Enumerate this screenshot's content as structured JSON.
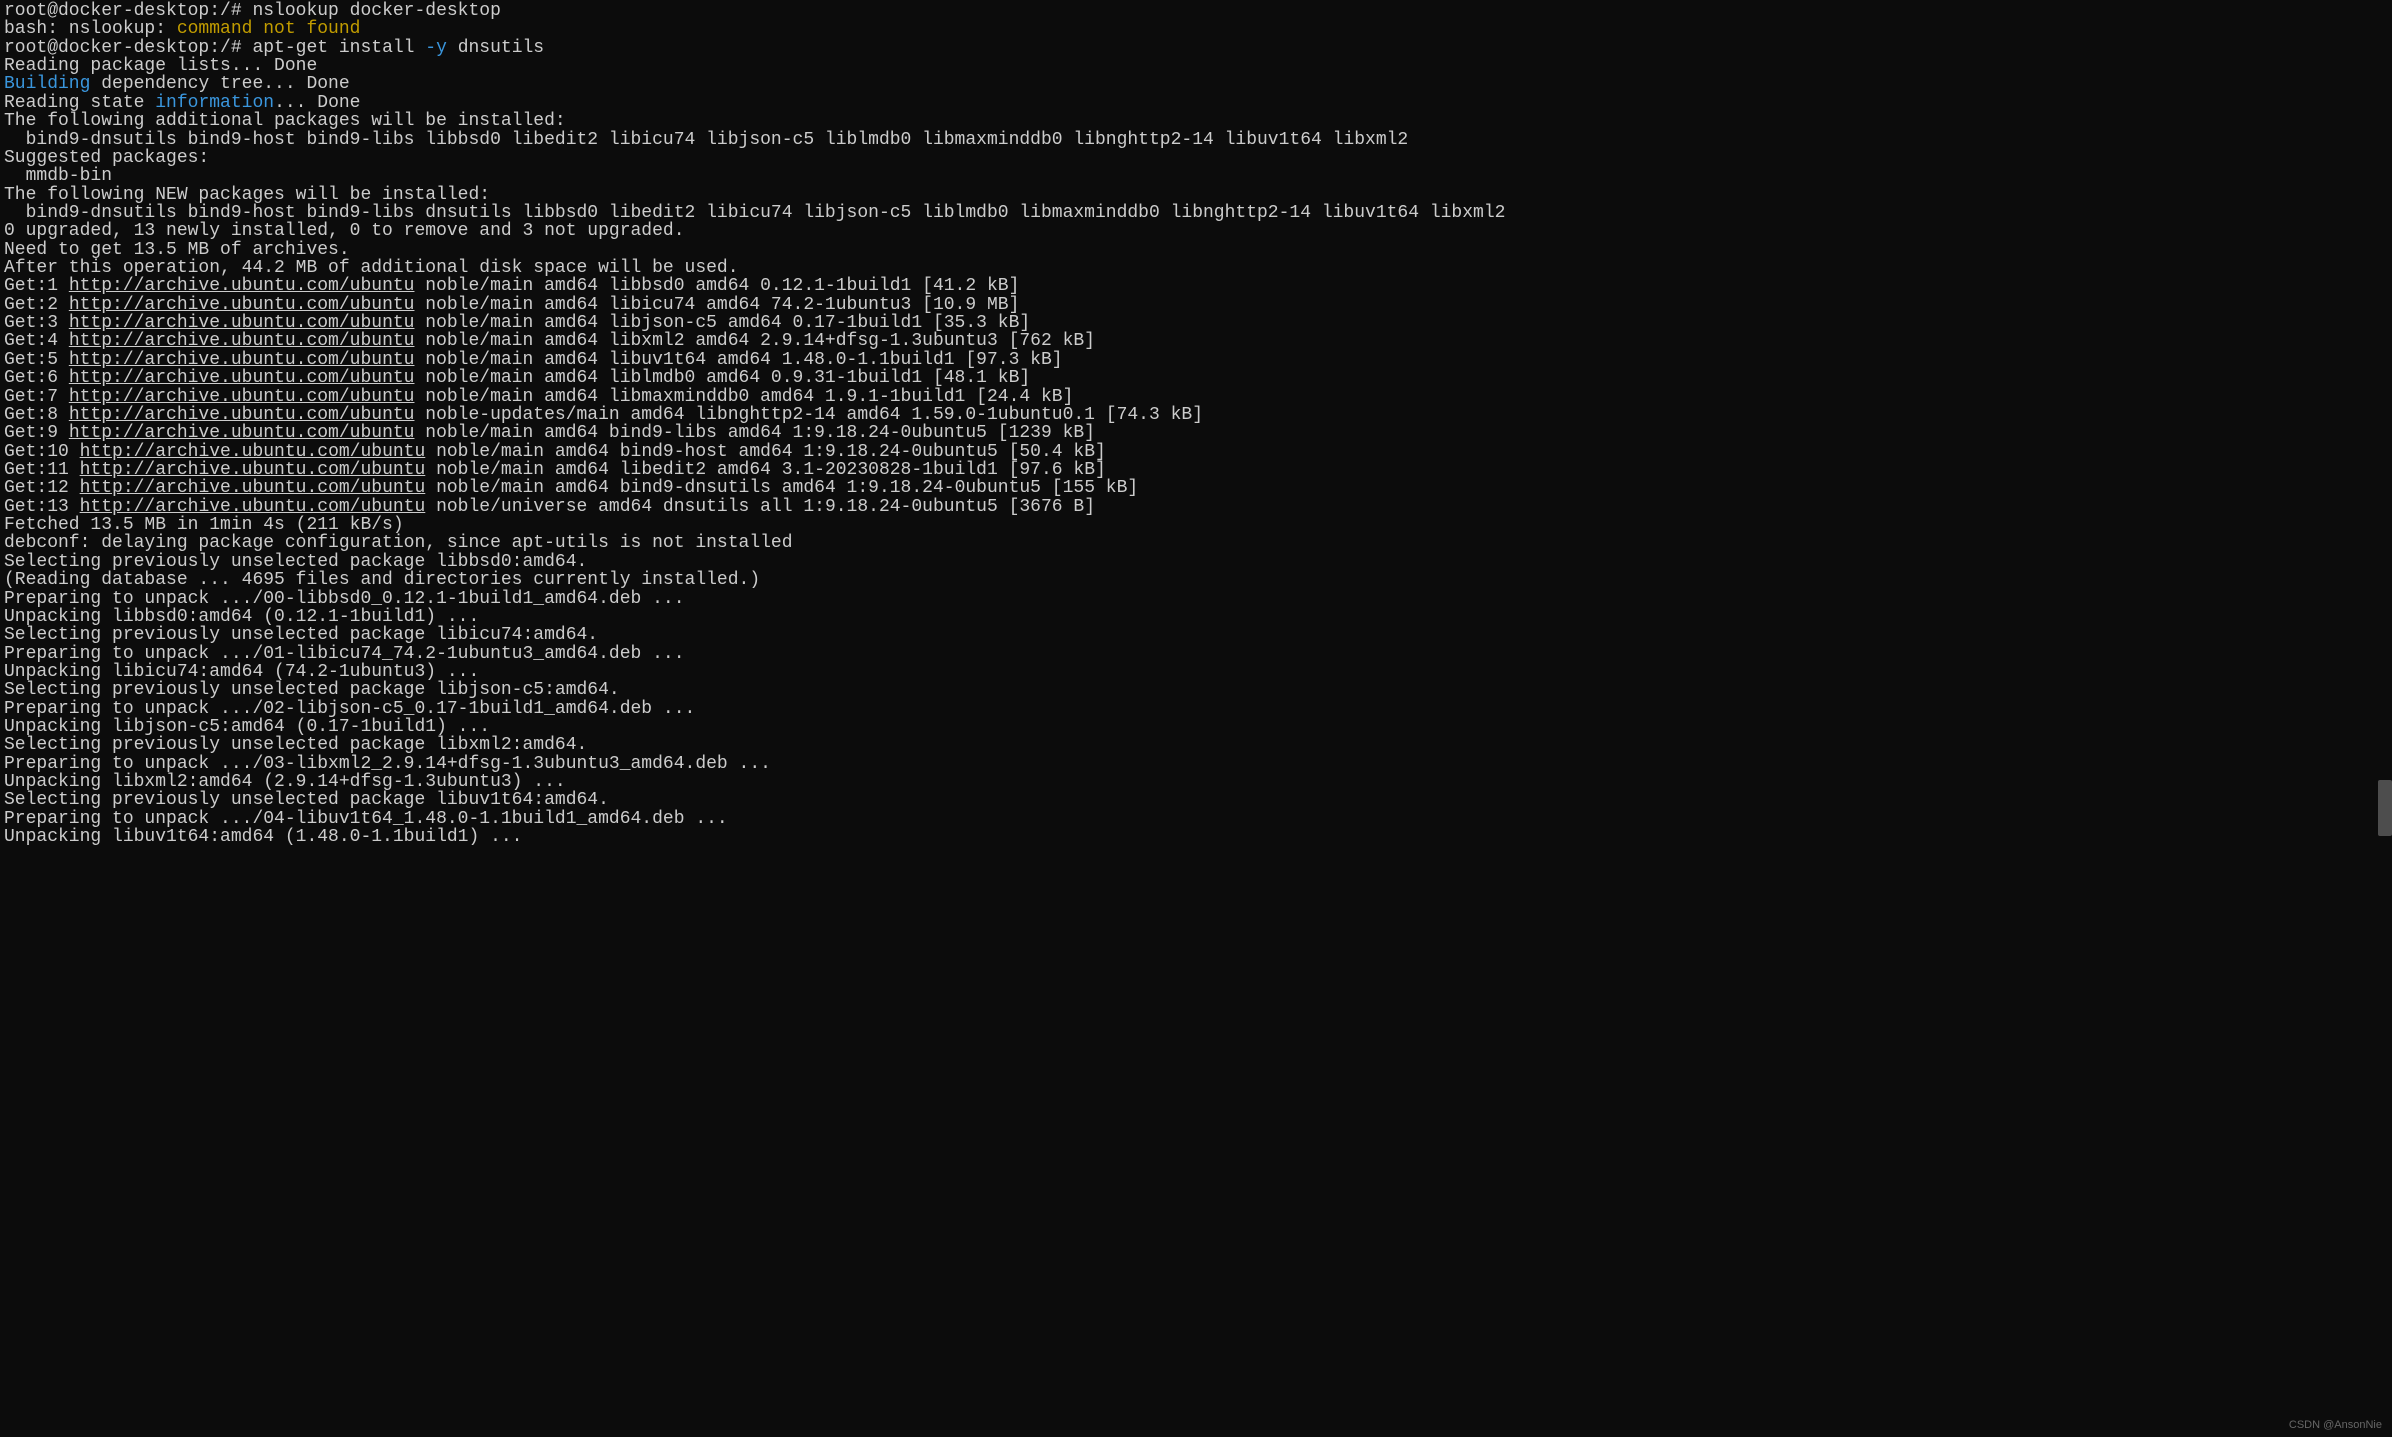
{
  "prompt1_user": "root@docker-desktop",
  "prompt1_dir": ":/#",
  "cmd1": " nslookup docker-desktop",
  "bash_err_pre": "bash: nslookup: ",
  "bash_err_msg": "command not found",
  "prompt2_user": "root@docker-desktop",
  "prompt2_dir": ":/#",
  "cmd2_a": " apt-get install ",
  "cmd2_flag": "-y",
  "cmd2_b": " dnsutils",
  "reading_pkg": "Reading package lists... Done",
  "building_word": "Building",
  "building_rest": " dependency tree... Done",
  "reading_state_a": "Reading state ",
  "reading_state_info": "information",
  "reading_state_b": "... Done",
  "additional_header": "The following additional packages will be installed:",
  "additional_list": "  bind9-dnsutils bind9-host bind9-libs libbsd0 libedit2 libicu74 libjson-c5 liblmdb0 libmaxminddb0 libnghttp2-14 libuv1t64 libxml2",
  "suggested_header": "Suggested packages:",
  "suggested_list": "  mmdb-bin",
  "new_header": "The following NEW packages will be installed:",
  "new_list": "  bind9-dnsutils bind9-host bind9-libs dnsutils libbsd0 libedit2 libicu74 libjson-c5 liblmdb0 libmaxminddb0 libnghttp2-14 libuv1t64 libxml2",
  "upgrade_summary": "0 upgraded, 13 newly installed, 0 to remove and 3 not upgraded.",
  "need_get": "Need to get 13.5 MB of archives.",
  "after_op": "After this operation, 44.2 MB of additional disk space will be used.",
  "archive_url": "http://archive.ubuntu.com/ubuntu",
  "gets": [
    {
      "n": "Get:1 ",
      "rest": " noble/main amd64 libbsd0 amd64 0.12.1-1build1 [41.2 kB]"
    },
    {
      "n": "Get:2 ",
      "rest": " noble/main amd64 libicu74 amd64 74.2-1ubuntu3 [10.9 MB]"
    },
    {
      "n": "Get:3 ",
      "rest": " noble/main amd64 libjson-c5 amd64 0.17-1build1 [35.3 kB]"
    },
    {
      "n": "Get:4 ",
      "rest": " noble/main amd64 libxml2 amd64 2.9.14+dfsg-1.3ubuntu3 [762 kB]"
    },
    {
      "n": "Get:5 ",
      "rest": " noble/main amd64 libuv1t64 amd64 1.48.0-1.1build1 [97.3 kB]"
    },
    {
      "n": "Get:6 ",
      "rest": " noble/main amd64 liblmdb0 amd64 0.9.31-1build1 [48.1 kB]"
    },
    {
      "n": "Get:7 ",
      "rest": " noble/main amd64 libmaxminddb0 amd64 1.9.1-1build1 [24.4 kB]"
    },
    {
      "n": "Get:8 ",
      "rest": " noble-updates/main amd64 libnghttp2-14 amd64 1.59.0-1ubuntu0.1 [74.3 kB]"
    },
    {
      "n": "Get:9 ",
      "rest": " noble/main amd64 bind9-libs amd64 1:9.18.24-0ubuntu5 [1239 kB]"
    },
    {
      "n": "Get:10 ",
      "rest": " noble/main amd64 bind9-host amd64 1:9.18.24-0ubuntu5 [50.4 kB]"
    },
    {
      "n": "Get:11 ",
      "rest": " noble/main amd64 libedit2 amd64 3.1-20230828-1build1 [97.6 kB]"
    },
    {
      "n": "Get:12 ",
      "rest": " noble/main amd64 bind9-dnsutils amd64 1:9.18.24-0ubuntu5 [155 kB]"
    },
    {
      "n": "Get:13 ",
      "rest": " noble/universe amd64 dnsutils all 1:9.18.24-0ubuntu5 [3676 B]"
    }
  ],
  "fetched": "Fetched 13.5 MB in 1min 4s (211 kB/s)",
  "debconf": "debconf: delaying package configuration, since apt-utils is not installed",
  "tail": [
    "Selecting previously unselected package libbsd0:amd64.",
    "(Reading database ... 4695 files and directories currently installed.)",
    "Preparing to unpack .../00-libbsd0_0.12.1-1build1_amd64.deb ...",
    "Unpacking libbsd0:amd64 (0.12.1-1build1) ...",
    "Selecting previously unselected package libicu74:amd64.",
    "Preparing to unpack .../01-libicu74_74.2-1ubuntu3_amd64.deb ...",
    "Unpacking libicu74:amd64 (74.2-1ubuntu3) ...",
    "Selecting previously unselected package libjson-c5:amd64.",
    "Preparing to unpack .../02-libjson-c5_0.17-1build1_amd64.deb ...",
    "Unpacking libjson-c5:amd64 (0.17-1build1) ...",
    "Selecting previously unselected package libxml2:amd64.",
    "Preparing to unpack .../03-libxml2_2.9.14+dfsg-1.3ubuntu3_amd64.deb ...",
    "Unpacking libxml2:amd64 (2.9.14+dfsg-1.3ubuntu3) ...",
    "Selecting previously unselected package libuv1t64:amd64.",
    "Preparing to unpack .../04-libuv1t64_1.48.0-1.1build1_amd64.deb ...",
    "Unpacking libuv1t64:amd64 (1.48.0-1.1build1) ..."
  ],
  "watermark": "CSDN @AnsonNie"
}
